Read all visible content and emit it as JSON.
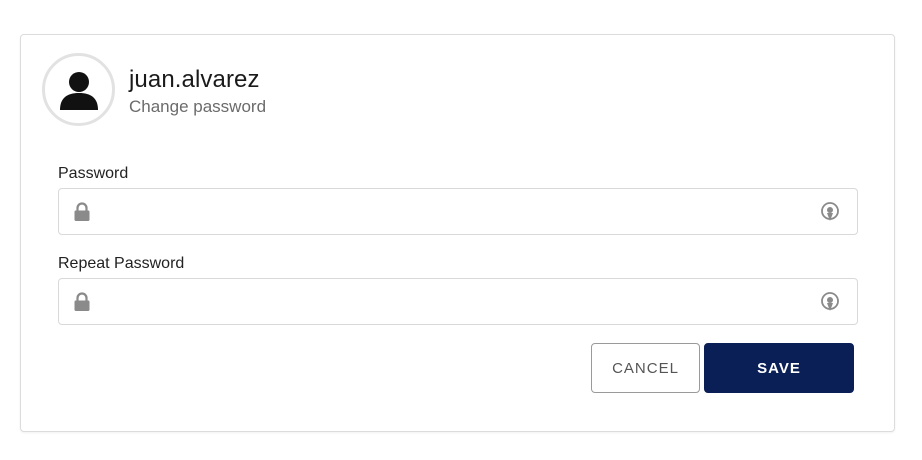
{
  "profile": {
    "username": "juan.alvarez",
    "subtitle": "Change password",
    "avatar_icon": "user-icon"
  },
  "form": {
    "password": {
      "label": "Password",
      "value": "",
      "leading_icon": "lock-icon",
      "trailing_icon": "eye-icon"
    },
    "repeat_password": {
      "label": "Repeat Password",
      "value": "",
      "leading_icon": "lock-icon",
      "trailing_icon": "eye-icon"
    }
  },
  "actions": {
    "cancel_label": "CANCEL",
    "save_label": "SAVE"
  },
  "colors": {
    "primary": "#0b1f57",
    "border": "#d9d9d9",
    "icon": "#8a8a8a"
  }
}
